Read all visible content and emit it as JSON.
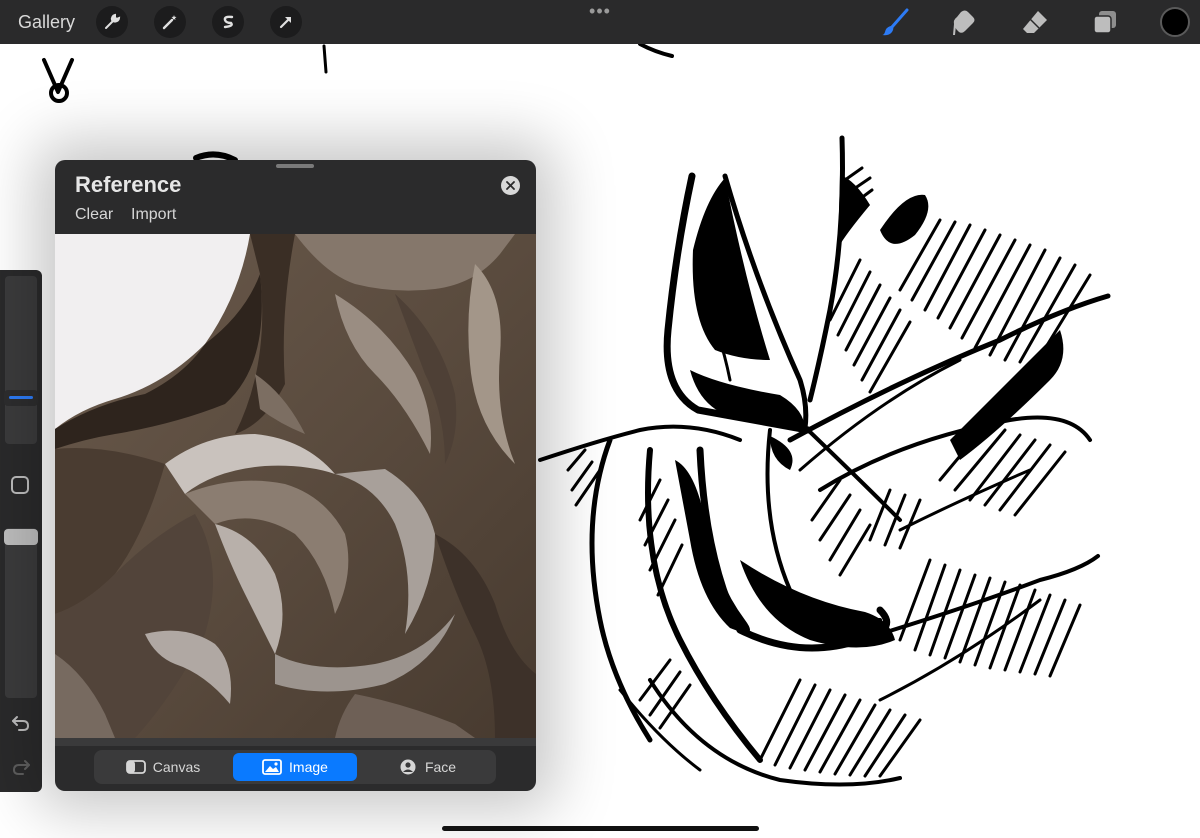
{
  "topbar": {
    "gallery_label": "Gallery",
    "left_tools": [
      "wrench-icon",
      "magic-wand-icon",
      "selection-icon",
      "transform-arrow-icon"
    ],
    "more_label": "•••",
    "right_tools": [
      "brush-icon",
      "smudge-icon",
      "eraser-icon",
      "layers-icon"
    ],
    "active_tool": "brush",
    "current_color": "#000000",
    "accent_color": "#2d7bf5"
  },
  "sidebar": {
    "brush_size_level": 0.72,
    "opacity_level": 1.0
  },
  "reference": {
    "title": "Reference",
    "actions": {
      "clear": "Clear",
      "import": "Import"
    },
    "tabs": [
      {
        "label": "Canvas",
        "icon": "canvas-icon",
        "active": false
      },
      {
        "label": "Image",
        "icon": "image-icon",
        "active": true
      },
      {
        "label": "Face",
        "icon": "face-icon",
        "active": false
      }
    ],
    "active_color": "#0a7aff"
  }
}
